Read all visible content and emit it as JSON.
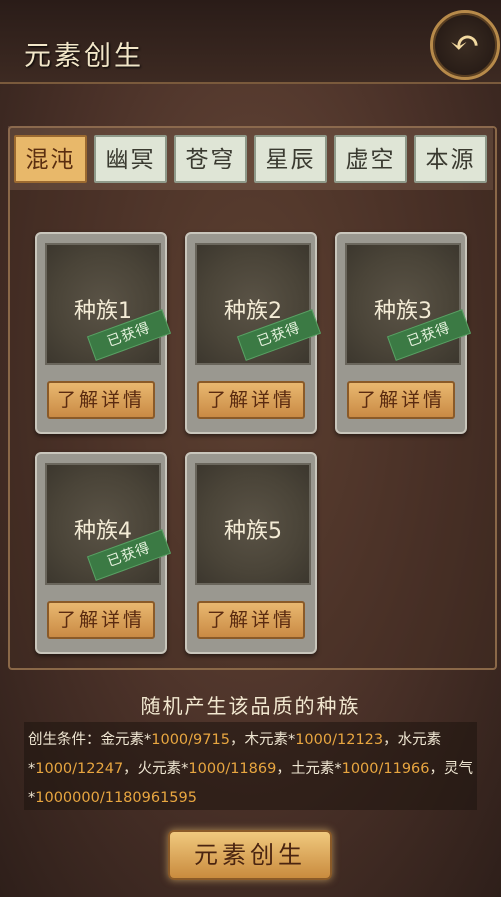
{
  "header": {
    "title": "元素创生"
  },
  "tabs": [
    {
      "label": "混沌",
      "active": true
    },
    {
      "label": "幽冥",
      "active": false
    },
    {
      "label": "苍穹",
      "active": false
    },
    {
      "label": "星辰",
      "active": false
    },
    {
      "label": "虚空",
      "active": false
    },
    {
      "label": "本源",
      "active": false
    }
  ],
  "cards": [
    {
      "name": "种族1",
      "badge": "已获得",
      "button": "了解详情"
    },
    {
      "name": "种族2",
      "badge": "已获得",
      "button": "了解详情"
    },
    {
      "name": "种族3",
      "badge": "已获得",
      "button": "了解详情"
    },
    {
      "name": "种族4",
      "badge": "已获得",
      "button": "了解详情"
    },
    {
      "name": "种族5",
      "badge": "",
      "button": "了解详情"
    }
  ],
  "description": "随机产生该品质的种族",
  "conditions": {
    "prefix": "创生条件：",
    "items": [
      {
        "name": "金元素*",
        "value": "1000/9715",
        "sep": "，"
      },
      {
        "name": "木元素*",
        "value": "1000/12123",
        "sep": "，"
      },
      {
        "name": "水元素*",
        "value": "1000/12247",
        "sep": "，"
      },
      {
        "name": "火元素*",
        "value": "1000/11869",
        "sep": "，"
      },
      {
        "name": "土元素*",
        "value": "1000/11966",
        "sep": "，"
      },
      {
        "name": "灵气*",
        "value": "1000000/1180961595",
        "sep": ""
      }
    ]
  },
  "create_button": "元素创生",
  "colors": {
    "accent": "#e8a640",
    "badge": "#3b7a44",
    "active_tab": "#e8b86a"
  }
}
